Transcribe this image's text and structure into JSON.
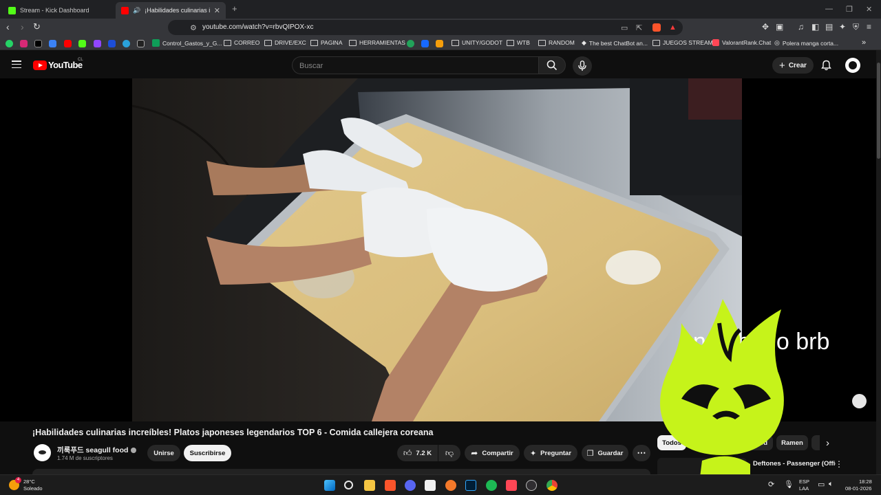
{
  "browser": {
    "tabs": [
      {
        "label": "Stream - Kick Dashboard",
        "icon": "kick-icon",
        "color": "#53fc18"
      },
      {
        "label": "¡Habilidades culinarias increíb",
        "icon": "youtube-icon",
        "color": "#ff0000"
      }
    ],
    "url": "youtube.com/watch?v=rbvQIPOX-xc",
    "bookmarks": [
      "Control_Gastos_y_G...",
      "CORREO",
      "DRIVE/EXC",
      "PAGINA",
      "HERRAMIENTAS",
      "UNITY/GODOT",
      "WTB",
      "RANDOM",
      "The best ChatBot an...",
      "JUEGOS STREAM",
      "ValorantRank.Chat",
      "Polera manga corta..."
    ]
  },
  "youtube": {
    "logo_text": "YouTube",
    "country": "CL",
    "search_placeholder": "Buscar",
    "create_label": "Crear",
    "overlay_text": "en el baño brb",
    "video_title": "¡Habilidades culinarias increíbles! Platos japoneses legendarios TOP 6 - Comida callejera coreana",
    "channel_name": "끼룩푸드 seagull food",
    "subscribers": "1.74 M de suscriptores",
    "join_label": "Unirse",
    "subscribe_label": "Suscribirse",
    "likes": "7.2 K",
    "share_label": "Compartir",
    "ask_label": "Preguntar",
    "save_label": "Guardar",
    "chips": [
      "Todos",
      "od",
      "Ramen"
    ],
    "related_title": "Deftones - Passenger (Official Visualizer)"
  },
  "taskbar": {
    "weather_temp": "28°C",
    "weather_text": "Soleado",
    "weather_badge": "4",
    "lang_top": "ESP",
    "lang_bottom": "LAA",
    "time": "18:28",
    "date": "08-01-2026"
  },
  "colors": {
    "accent_red": "#ff0000",
    "mascot_green": "#c6f31a"
  }
}
